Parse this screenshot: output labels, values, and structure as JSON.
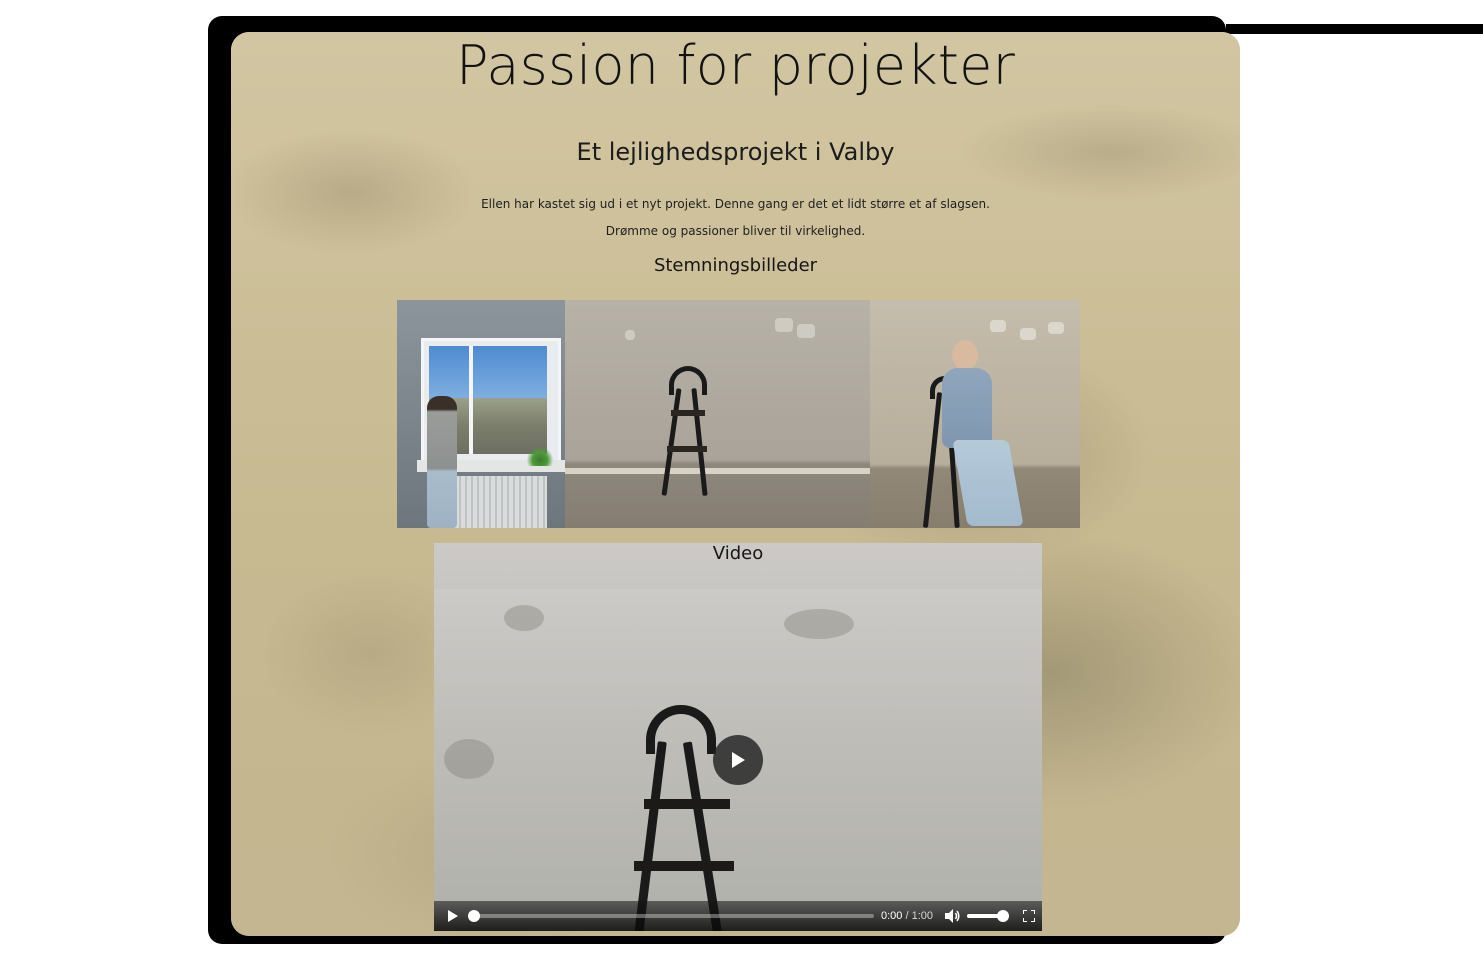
{
  "page": {
    "title": "Passion for projekter",
    "subtitle": "Et lejlighedsprojekt i Valby",
    "paragraphs": [
      "Ellen har kastet sig ud i et nyt projekt. Denne gang er det et lidt større et af slagsen.",
      "Drømme og passioner bliver til virkelighed."
    ]
  },
  "gallery": {
    "heading": "Stemningsbilleder",
    "images": [
      {
        "icon": "photo-woman-at-window"
      },
      {
        "icon": "photo-ladder-empty-room"
      },
      {
        "icon": "photo-woman-on-ladder"
      }
    ]
  },
  "video": {
    "heading": "Video",
    "current_time": "0:00",
    "separator": " / ",
    "duration": "1:00",
    "progress": 0.0,
    "volume": 0.85,
    "icons": {
      "big_play": "play-icon",
      "play": "play-icon",
      "volume": "speaker-icon",
      "fullscreen": "fullscreen-icon"
    }
  },
  "colors": {
    "background": "#cabd98",
    "text": "#121212",
    "frame": "#000000"
  }
}
